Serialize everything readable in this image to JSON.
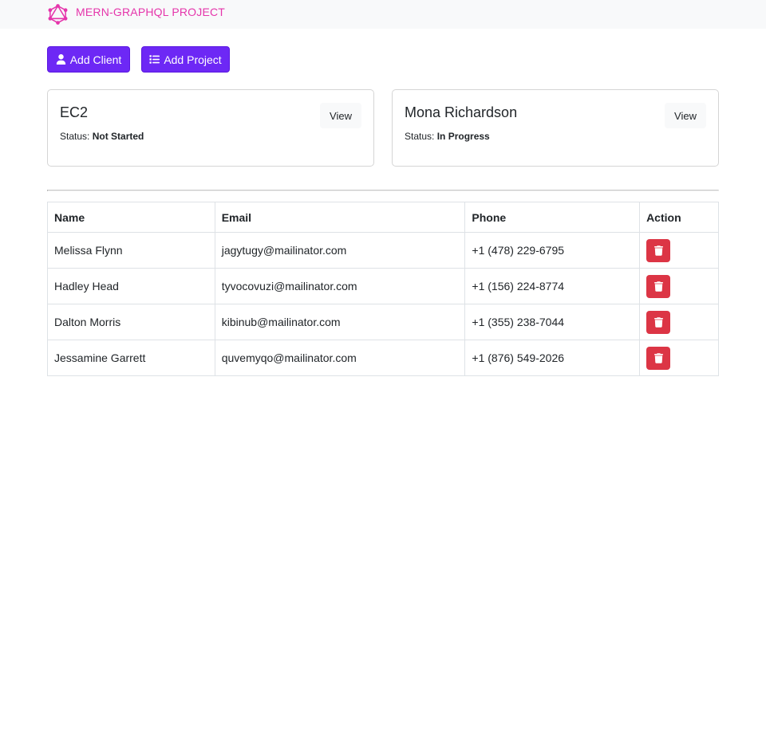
{
  "navbar": {
    "brand_text": "MERN-GraphQL Project",
    "logo_icon": "graphql-logo-icon",
    "brand_color": "#e535ab"
  },
  "actions": {
    "add_client_label": "Add Client",
    "add_client_icon": "user-icon",
    "add_project_label": "Add Project",
    "add_project_icon": "list-icon",
    "accent_color": "#6d28f5"
  },
  "projects": [
    {
      "name": "EC2",
      "status_label": "Status:",
      "status": "Not Started",
      "view_label": "View"
    },
    {
      "name": "Mona Richardson",
      "status_label": "Status:",
      "status": "In Progress",
      "view_label": "View"
    }
  ],
  "clients_table": {
    "headers": [
      "Name",
      "Email",
      "Phone",
      "Action"
    ],
    "rows": [
      {
        "name": "Melissa Flynn",
        "email": "jagytugy@mailinator.com",
        "phone": "+1 (478) 229-6795"
      },
      {
        "name": "Hadley Head",
        "email": "tyvocovuzi@mailinator.com",
        "phone": "+1 (156) 224-8774"
      },
      {
        "name": "Dalton Morris",
        "email": "kibinub@mailinator.com",
        "phone": "+1 (355) 238-7044"
      },
      {
        "name": "Jessamine Garrett",
        "email": "quvemyqo@mailinator.com",
        "phone": "+1 (876) 549-2026"
      }
    ],
    "delete_icon": "trash-icon",
    "delete_color": "#dc3545"
  }
}
